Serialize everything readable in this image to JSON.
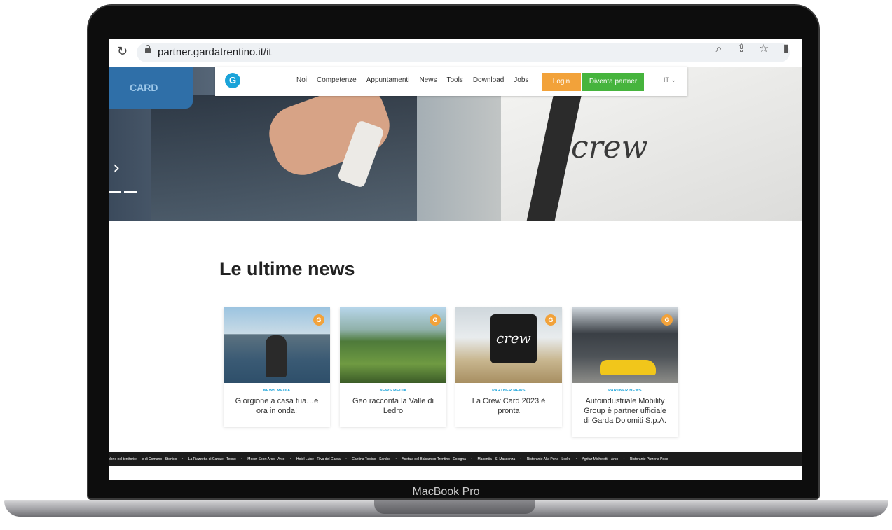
{
  "device": {
    "label": "MacBook Pro"
  },
  "browser": {
    "url": "partner.gardatrentino.it/it",
    "icons": [
      "reload-icon",
      "lock-icon",
      "zoom-icon",
      "share-icon",
      "bookmark-star-icon",
      "side-panel-icon"
    ]
  },
  "nav": {
    "logo_text": "G",
    "links": [
      "Noi",
      "Competenze",
      "Appuntamenti",
      "News",
      "Tools",
      "Download",
      "Jobs"
    ],
    "login_label": "Login",
    "partner_label": "Diventa partner",
    "lang_label": "IT ⌄"
  },
  "hero": {
    "card_text": "CARD",
    "shirt_text": "crew",
    "arrow": "›"
  },
  "news": {
    "title": "Le ultime news",
    "badge": "G",
    "cards": [
      {
        "category": "NEWS MEDIA",
        "title": "Giorgione a casa tua…e ora in onda!"
      },
      {
        "category": "NEWS MEDIA",
        "title": "Geo racconta la Valle di Ledro"
      },
      {
        "category": "PARTNER NEWS",
        "title": "La Crew Card 2023 è pronta",
        "image_text": "crew"
      },
      {
        "category": "PARTNER NEWS",
        "title": "Autoindustriale Mobility Group è partner ufficiale di Garda Dolomiti S.p.A."
      }
    ]
  },
  "ticker": {
    "items": [
      "dono nel territorio:",
      "e di Comano · Stenico",
      "•",
      "La Piazzetta di Canale · Tenno",
      "•",
      "Moser Sport Arco · Arco",
      "•",
      "Hotel Luise · Riva del Garda",
      "•",
      "Cantina Toblino · Sarche",
      "•",
      "Acetaia del Balsamico Trentino · Cologna",
      "•",
      "Maxentia · S. Massenza",
      "•",
      "Ristorante Alla Perla · Ledro",
      "•",
      "Agritur Michelotti · Arco",
      "•",
      "Ristorante Pizzeria Pace"
    ]
  }
}
